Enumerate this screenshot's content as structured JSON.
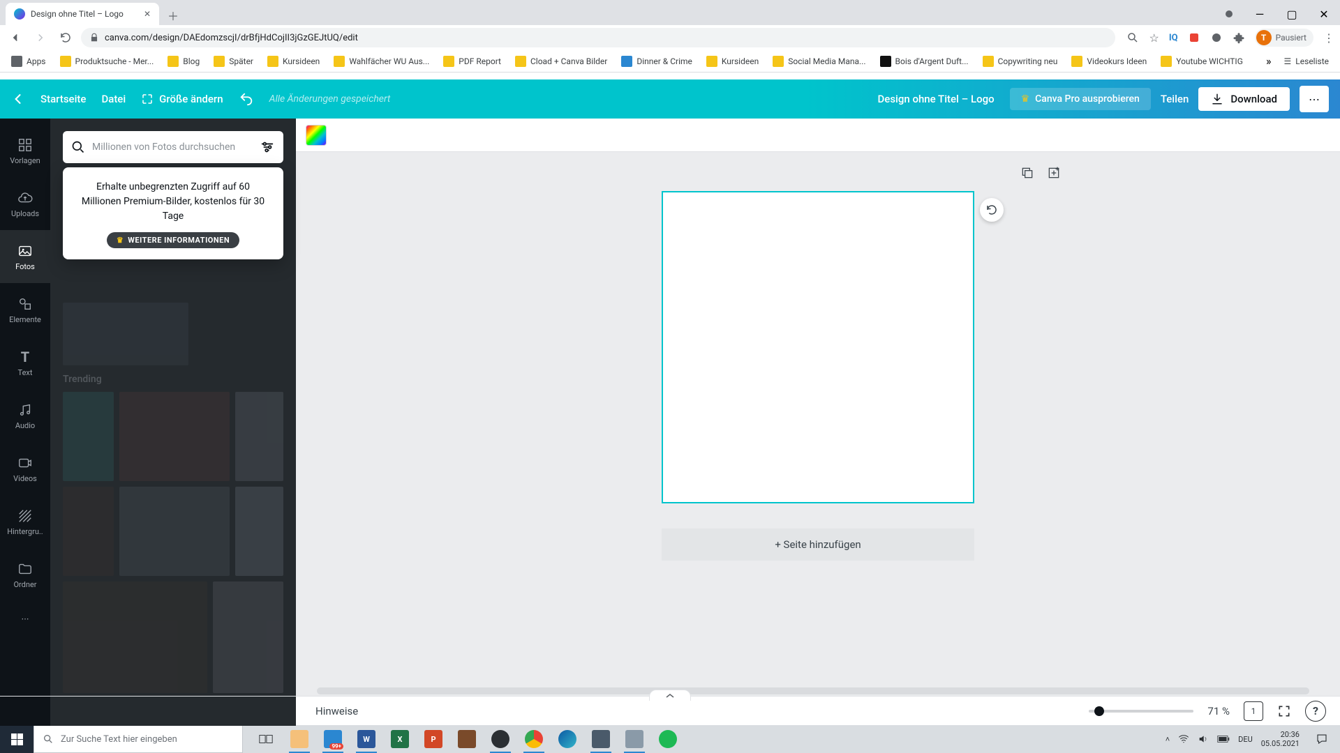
{
  "browser": {
    "tab_title": "Design ohne Titel – Logo",
    "url": "canva.com/design/DAEdomzscjI/drBfjHdCojII3jGzGEJtUQ/edit",
    "profile_status": "Pausiert",
    "profile_initial": "T",
    "bookmarks": [
      "Apps",
      "Produktsuche - Mer...",
      "Blog",
      "Später",
      "Kursideen",
      "Wahlfächer WU Aus...",
      "PDF Report",
      "Cload + Canva Bilder",
      "Dinner & Crime",
      "Kursideen",
      "Social Media Mana...",
      "Bois d'Argent Duft...",
      "Copywriting neu",
      "Videokurs Ideen",
      "Youtube WICHTIG"
    ],
    "reading_list": "Leseliste"
  },
  "canva_top": {
    "home": "Startseite",
    "file": "Datei",
    "resize": "Größe ändern",
    "saved": "Alle Änderungen gespeichert",
    "title": "Design ohne Titel – Logo",
    "try_pro": "Canva Pro ausprobieren",
    "share": "Teilen",
    "download": "Download"
  },
  "vnav": {
    "items": [
      "Vorlagen",
      "Uploads",
      "Fotos",
      "Elemente",
      "Text",
      "Audio",
      "Videos",
      "Hintergru..",
      "Ordner"
    ],
    "active_index": 2
  },
  "side": {
    "search_placeholder": "Millionen von Fotos durchsuchen",
    "popover_text": "Erhalte unbegrenzten Zugriff auf 60 Millionen Premium-Bilder, kostenlos für 30 Tage",
    "popover_button": "WEITERE INFORMATIONEN",
    "section_label": "Trending"
  },
  "canvas": {
    "add_page": "+ Seite hinzufügen"
  },
  "status": {
    "hints": "Hinweise",
    "zoom": "71 %",
    "page_count": "1"
  },
  "taskbar": {
    "search_placeholder": "Zur Suche Text hier eingeben",
    "lang": "DEU",
    "time": "20:36",
    "date": "05.05.2021",
    "badge": "99+"
  }
}
